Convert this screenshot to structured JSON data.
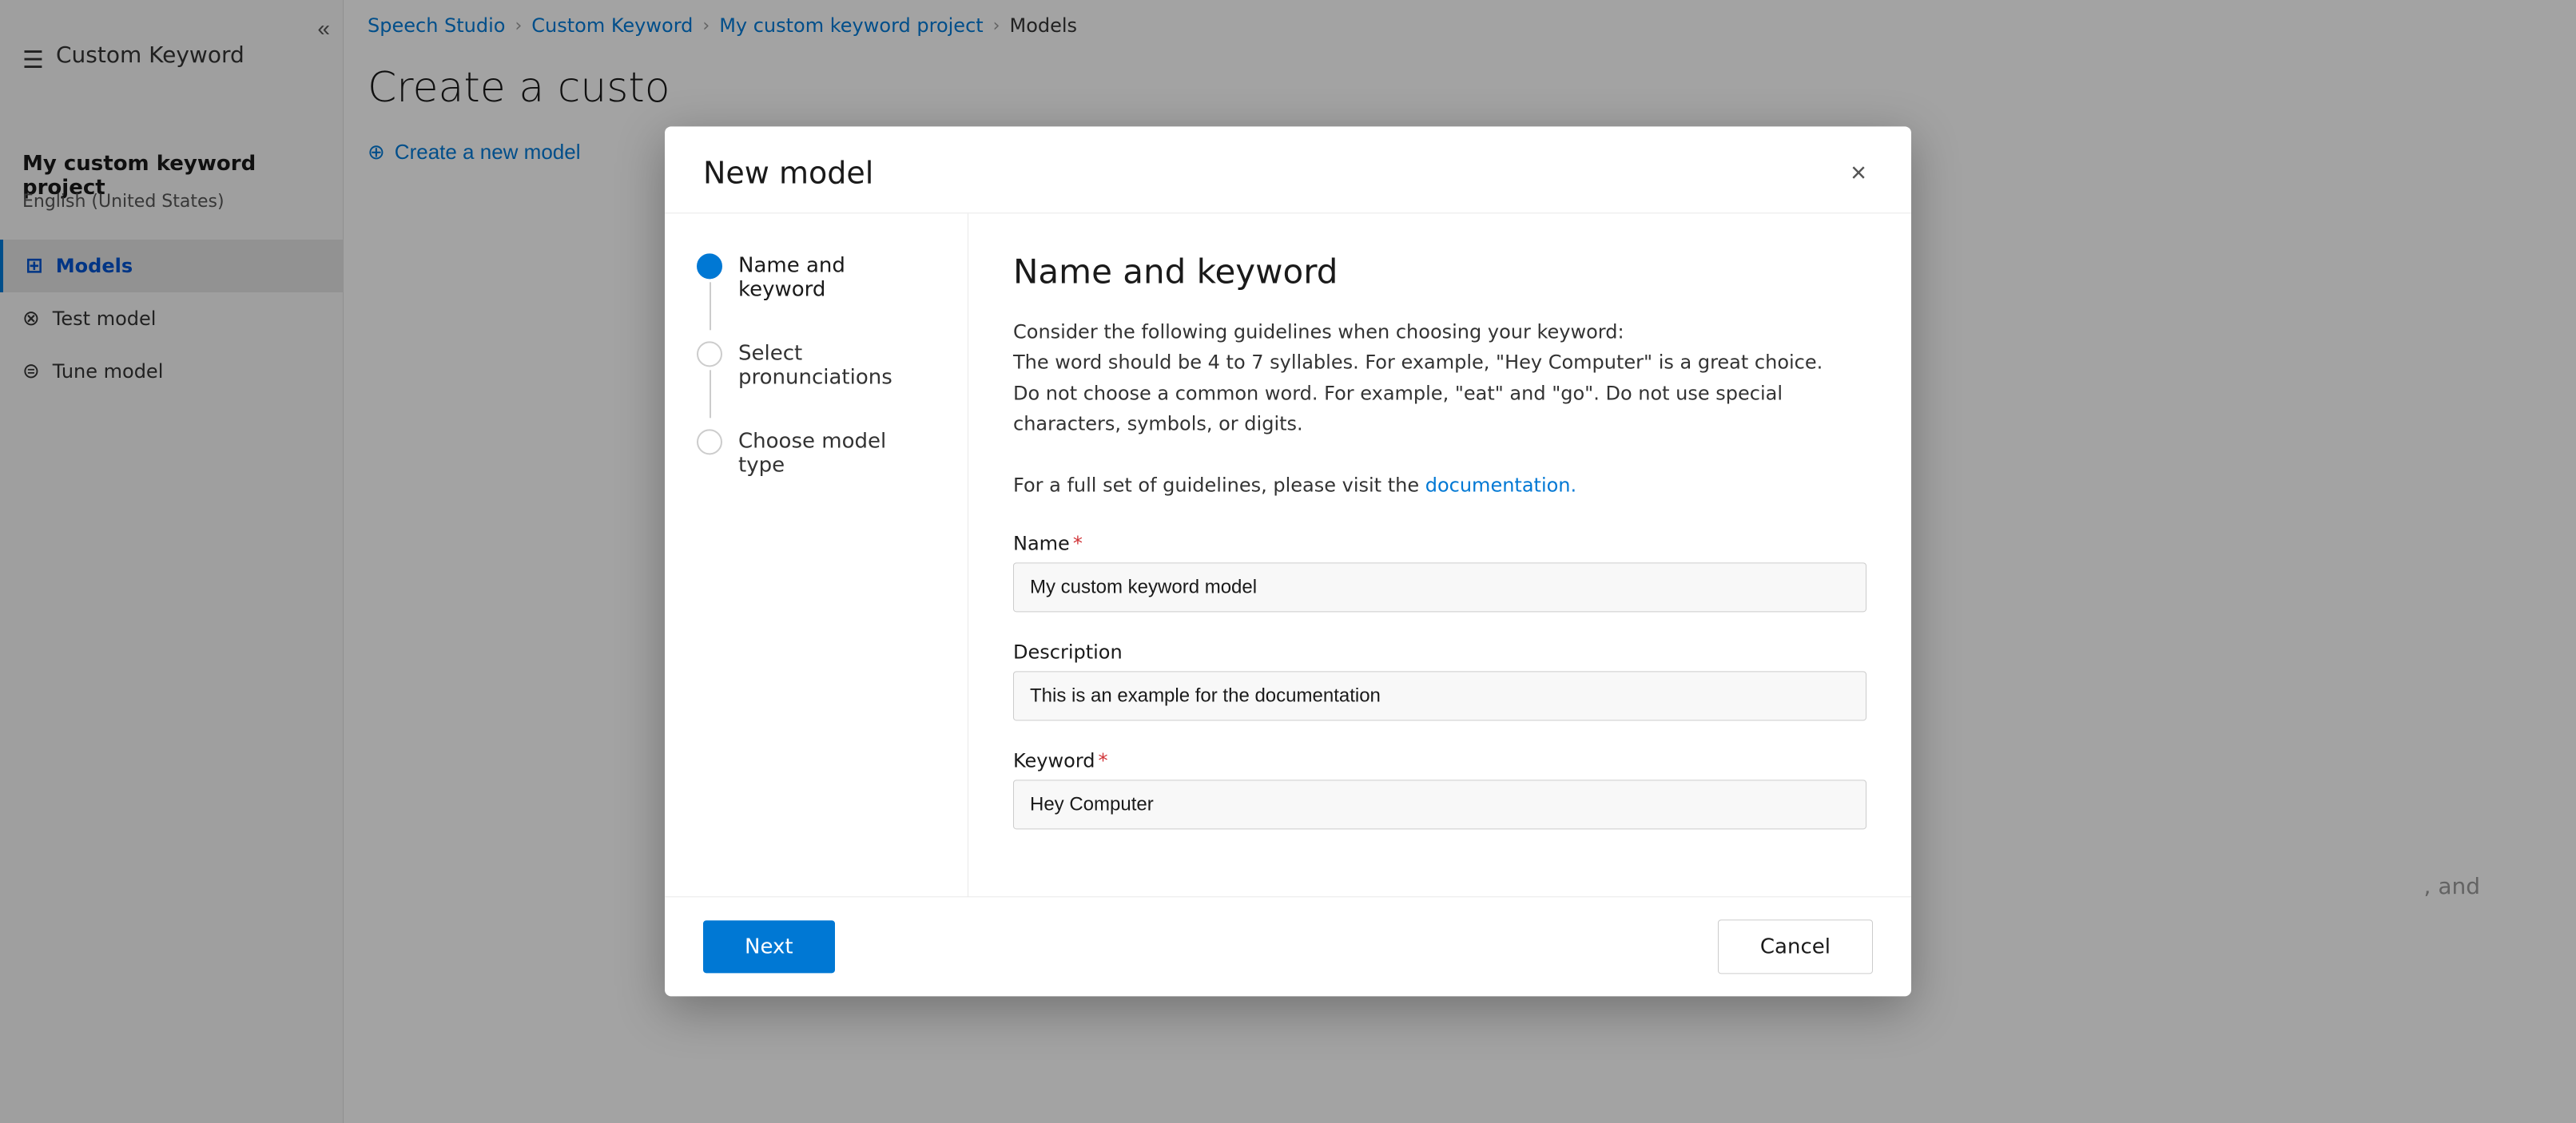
{
  "app": {
    "title": "Custom Keyword",
    "studio_name": "Speech Studio"
  },
  "sidebar": {
    "collapse_icon": "«",
    "menu_icon": "☰",
    "project_name": "My custom keyword project",
    "project_language": "English (United States)",
    "nav_items": [
      {
        "id": "models",
        "label": "Models",
        "icon": "⊞",
        "active": true
      },
      {
        "id": "test-model",
        "label": "Test model",
        "icon": "⊗"
      },
      {
        "id": "tune-model",
        "label": "Tune model",
        "icon": "⊜"
      }
    ]
  },
  "breadcrumb": {
    "items": [
      {
        "label": "Speech Studio",
        "link": true
      },
      {
        "label": "Custom Keyword",
        "link": true
      },
      {
        "label": "My custom keyword project",
        "link": true
      },
      {
        "label": "Models",
        "link": false
      }
    ]
  },
  "page": {
    "heading": "Create a custo",
    "create_button_label": "Create a new model"
  },
  "modal": {
    "title": "New model",
    "close_icon": "×",
    "steps": [
      {
        "id": "name-keyword",
        "label": "Name and keyword",
        "active": true
      },
      {
        "id": "select-pronunciations",
        "label": "Select pronunciations",
        "active": false
      },
      {
        "id": "choose-model-type",
        "label": "Choose model type",
        "active": false
      }
    ],
    "content": {
      "heading": "Name and keyword",
      "guidelines": {
        "line1": "Consider the following guidelines when choosing your keyword:",
        "line2": "The word should be 4 to 7 syllables. For example, \"Hey Computer\" is a great choice.",
        "line3": "Do not choose a common word. For example, \"eat\" and \"go\". Do not use special characters, symbols, or digits.",
        "line4": "For a full set of guidelines, please visit the",
        "link_text": "documentation.",
        "link_url": "#"
      },
      "form": {
        "name_label": "Name",
        "name_required": "*",
        "name_value": "My custom keyword model",
        "description_label": "Description",
        "description_value": "This is an example for the documentation",
        "keyword_label": "Keyword",
        "keyword_required": "*",
        "keyword_value": "Hey Computer"
      }
    },
    "footer": {
      "next_label": "Next",
      "cancel_label": "Cancel"
    }
  }
}
